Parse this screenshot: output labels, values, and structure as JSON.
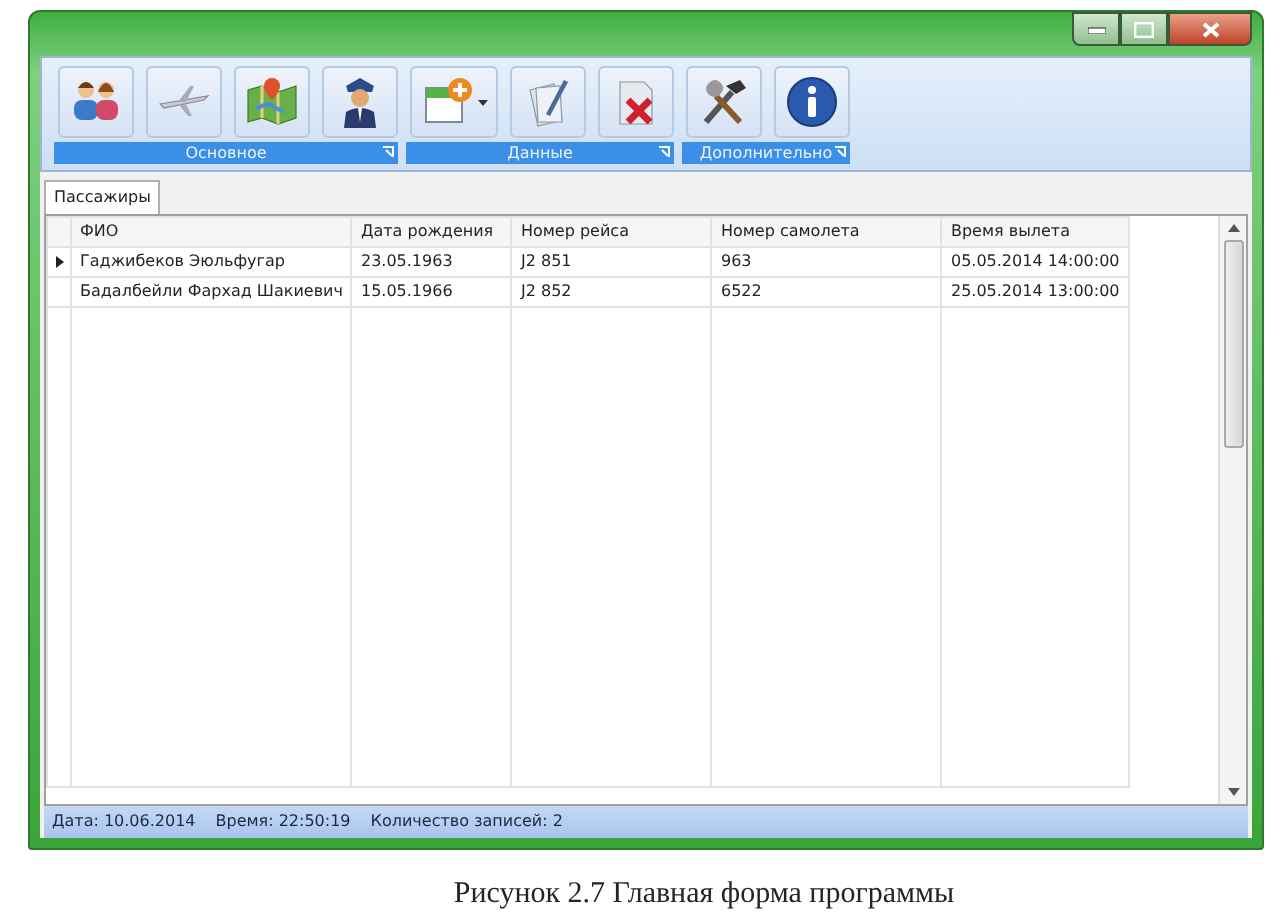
{
  "ribbon": {
    "groups": [
      {
        "label": "Основное",
        "buttons": [
          {
            "dropdown": false
          },
          {
            "dropdown": false
          },
          {
            "dropdown": false
          },
          {
            "dropdown": false
          }
        ]
      },
      {
        "label": "Данные",
        "buttons": [
          {
            "dropdown": true
          },
          {
            "dropdown": false
          },
          {
            "dropdown": false
          }
        ]
      },
      {
        "label": "Дополнительно",
        "buttons": [
          {
            "dropdown": false
          },
          {
            "dropdown": false
          }
        ]
      }
    ]
  },
  "tabs": [
    {
      "label": "Пассажиры",
      "selected": true
    }
  ],
  "table": {
    "columns": [
      "ФИО",
      "Дата рождения",
      "Номер рейса",
      "Номер самолета",
      "Время вылета"
    ],
    "rows": [
      {
        "current": true,
        "cells": [
          "Гаджибеков Эюльфугар",
          "23.05.1963",
          "J2 851",
          "963",
          "05.05.2014 14:00:00"
        ]
      },
      {
        "current": false,
        "cells": [
          "Бадалбейли Фархад Шакиевич",
          "15.05.1966",
          "J2 852",
          "6522",
          "25.05.2014 13:00:00"
        ]
      }
    ]
  },
  "status_bar": [
    "Дата: 10.06.2014",
    "Время: 22:50:19",
    "Количество записей: 2"
  ],
  "caption": "Рисунок 2.7 Главная форма программы"
}
